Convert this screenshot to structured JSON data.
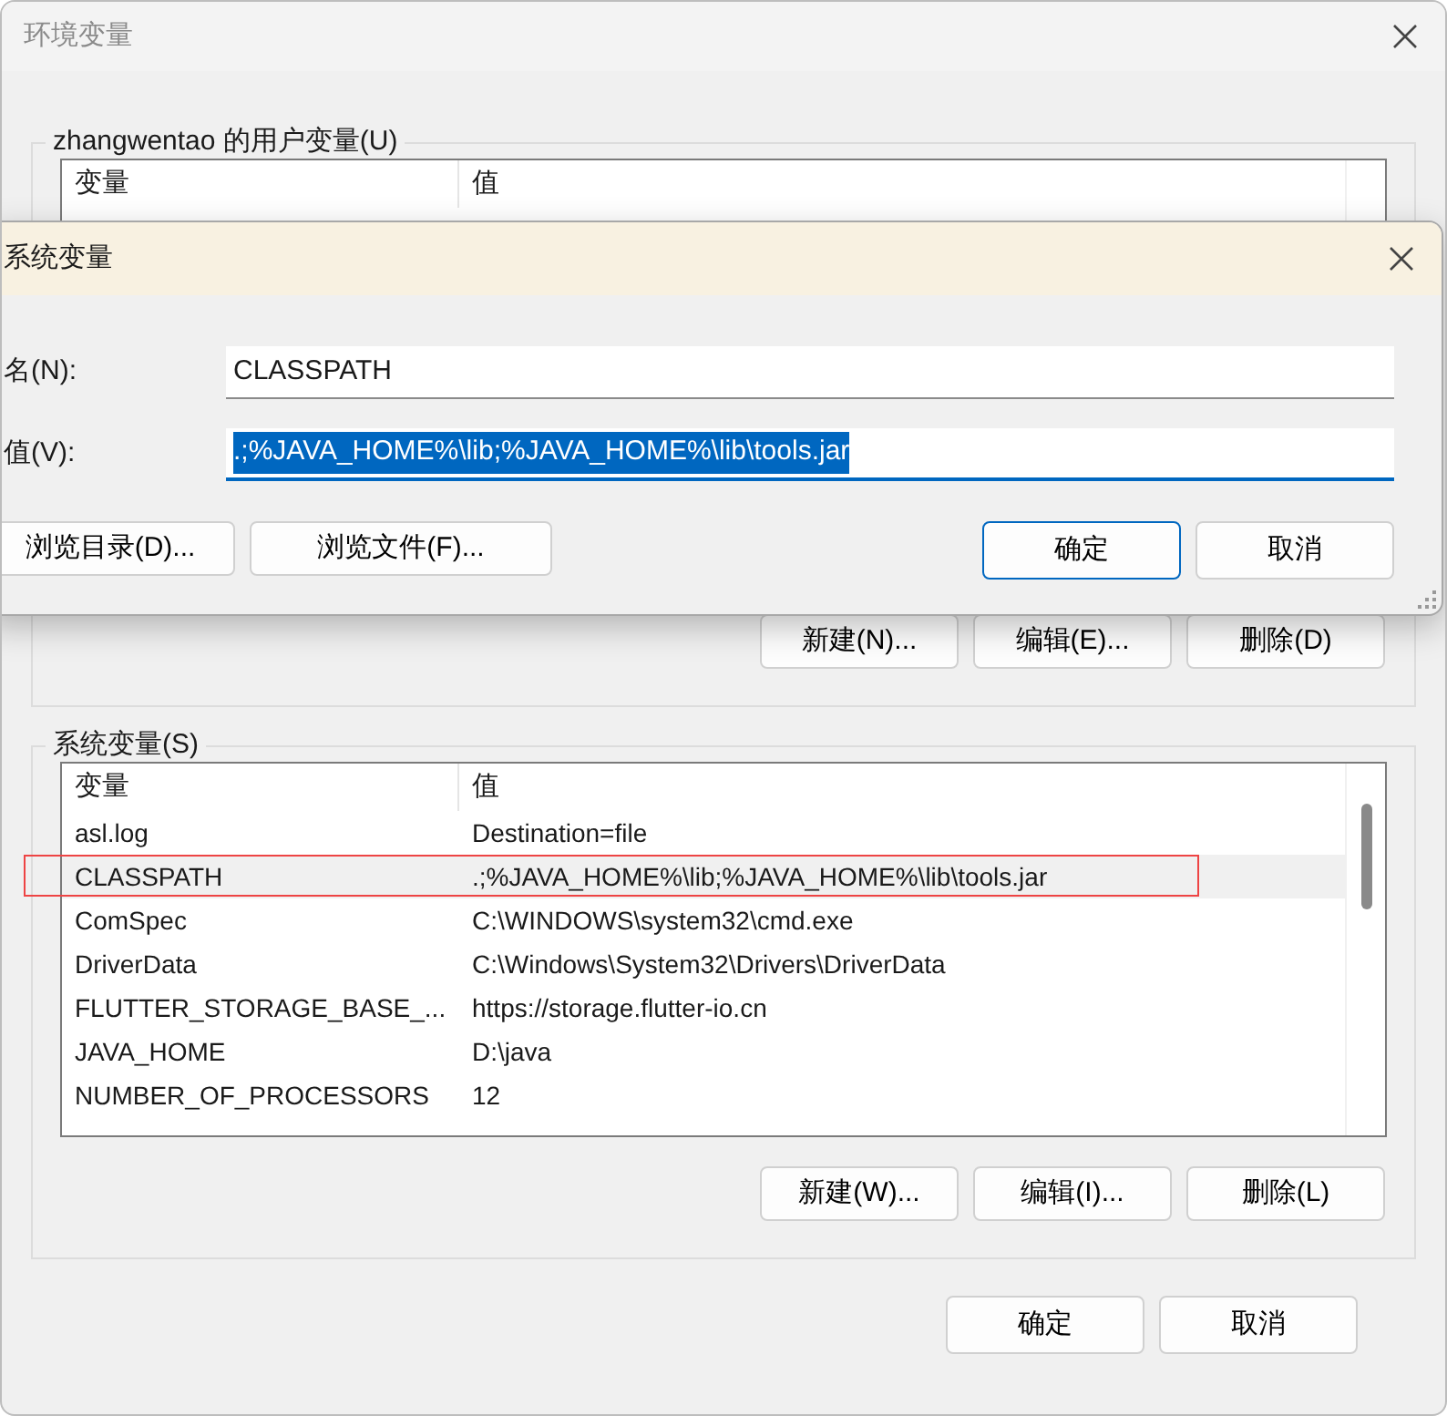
{
  "window": {
    "title": "环境变量"
  },
  "user_variables": {
    "label": "zhangwentao 的用户变量(U)",
    "columns": [
      "变量",
      "值"
    ],
    "buttons": [
      "新建(N)...",
      "编辑(E)...",
      "删除(D)"
    ]
  },
  "system_variables": {
    "label": "系统变量(S)",
    "columns": [
      "变量",
      "值"
    ],
    "rows": [
      {
        "name": "asl.log",
        "value": "Destination=file",
        "selected": false,
        "outlined": false
      },
      {
        "name": "CLASSPATH",
        "value": ".;%JAVA_HOME%\\lib;%JAVA_HOME%\\lib\\tools.jar",
        "selected": true,
        "outlined": true
      },
      {
        "name": "ComSpec",
        "value": "C:\\WINDOWS\\system32\\cmd.exe",
        "selected": false,
        "outlined": false
      },
      {
        "name": "DriverData",
        "value": "C:\\Windows\\System32\\Drivers\\DriverData",
        "selected": false,
        "outlined": false
      },
      {
        "name": "FLUTTER_STORAGE_BASE_...",
        "value": "https://storage.flutter-io.cn",
        "selected": false,
        "outlined": false
      },
      {
        "name": "JAVA_HOME",
        "value": "D:\\java",
        "selected": false,
        "outlined": false
      },
      {
        "name": "NUMBER_OF_PROCESSORS",
        "value": "12",
        "selected": false,
        "outlined": false
      }
    ],
    "buttons": [
      "新建(W)...",
      "编辑(I)...",
      "删除(L)"
    ]
  },
  "buttons": [
    "确定",
    "取消"
  ],
  "edit_dialog": {
    "title": "系统变量",
    "fields": [
      {
        "label": "名(N):",
        "value": "CLASSPATH",
        "focused": false,
        "text_selected": false
      },
      {
        "label": "值(V):",
        "value": ".;%JAVA_HOME%\\lib;%JAVA_HOME%\\lib\\tools.jar",
        "focused": true,
        "text_selected": true
      }
    ],
    "left_buttons": [
      "浏览目录(D)...",
      "浏览文件(F)..."
    ],
    "buttons": [
      {
        "label": "确定",
        "default": true
      },
      {
        "label": "取消",
        "default": false
      }
    ]
  }
}
